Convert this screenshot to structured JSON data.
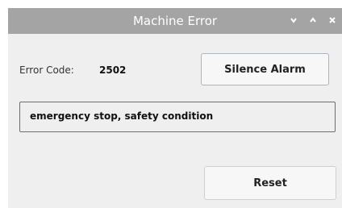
{
  "window": {
    "title": "Machine Error",
    "controls": [
      "minimize-icon",
      "maximize-icon",
      "close-icon"
    ]
  },
  "error": {
    "code_label": "Error Code:",
    "code_value": "2502",
    "message": "emergency stop, safety condition"
  },
  "buttons": {
    "silence_label": "Silence Alarm",
    "reset_label": "Reset"
  }
}
